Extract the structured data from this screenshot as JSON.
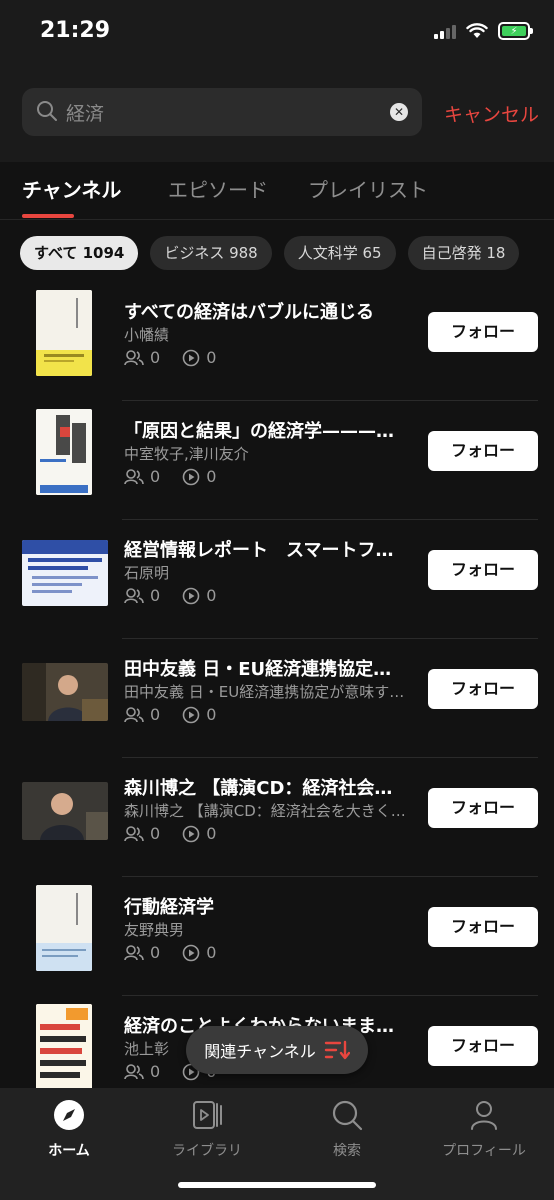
{
  "status_bar": {
    "time": "21:29"
  },
  "search": {
    "query": "経済",
    "cancel_label": "キャンセル"
  },
  "tabs": [
    {
      "label": "チャンネル",
      "active": true
    },
    {
      "label": "エピソード",
      "active": false
    },
    {
      "label": "プレイリスト",
      "active": false
    }
  ],
  "chips": [
    {
      "label": "すべて 1094",
      "active": true
    },
    {
      "label": "ビジネス 988",
      "active": false
    },
    {
      "label": "人文科学 65",
      "active": false
    },
    {
      "label": "自己啓発 18",
      "active": false
    }
  ],
  "follow_label": "フォロー",
  "results": [
    {
      "title": "すべての経済はバブルに通じる",
      "author": "小幡績",
      "followers": "0",
      "plays": "0",
      "thumb": "book-yellow"
    },
    {
      "title": "「原因と結果」の経済学———…",
      "author": "中室牧子,津川友介",
      "followers": "0",
      "plays": "0",
      "thumb": "book-white"
    },
    {
      "title": "経営情報レポート　スマートフ…",
      "author": "石原明",
      "followers": "0",
      "plays": "0",
      "thumb": "report-blue"
    },
    {
      "title": "田中友義 日・EU経済連携協定…",
      "author": "田中友義 日・EU経済連携協定が意味す…",
      "followers": "0",
      "plays": "0",
      "thumb": "photo-1"
    },
    {
      "title": "森川博之 【講演CD：経済社会…",
      "author": "森川博之 【講演CD：経済社会を大きく…",
      "followers": "0",
      "plays": "0",
      "thumb": "photo-2"
    },
    {
      "title": "行動経済学",
      "author": "友野典男",
      "followers": "0",
      "plays": "0",
      "thumb": "book-blue"
    },
    {
      "title": "経済のことよくわからないまま…",
      "author": "池上彰",
      "followers": "0",
      "plays": "0",
      "thumb": "book-orange"
    }
  ],
  "related": {
    "label": "関連チャンネル"
  },
  "bottom_nav": [
    {
      "label": "ホーム",
      "icon": "compass-icon",
      "active": true
    },
    {
      "label": "ライブラリ",
      "icon": "library-icon",
      "active": false
    },
    {
      "label": "検索",
      "icon": "search-icon",
      "active": false
    },
    {
      "label": "プロフィール",
      "icon": "profile-icon",
      "active": false
    }
  ],
  "colors": {
    "accent": "#e8463f",
    "background": "#121212"
  }
}
